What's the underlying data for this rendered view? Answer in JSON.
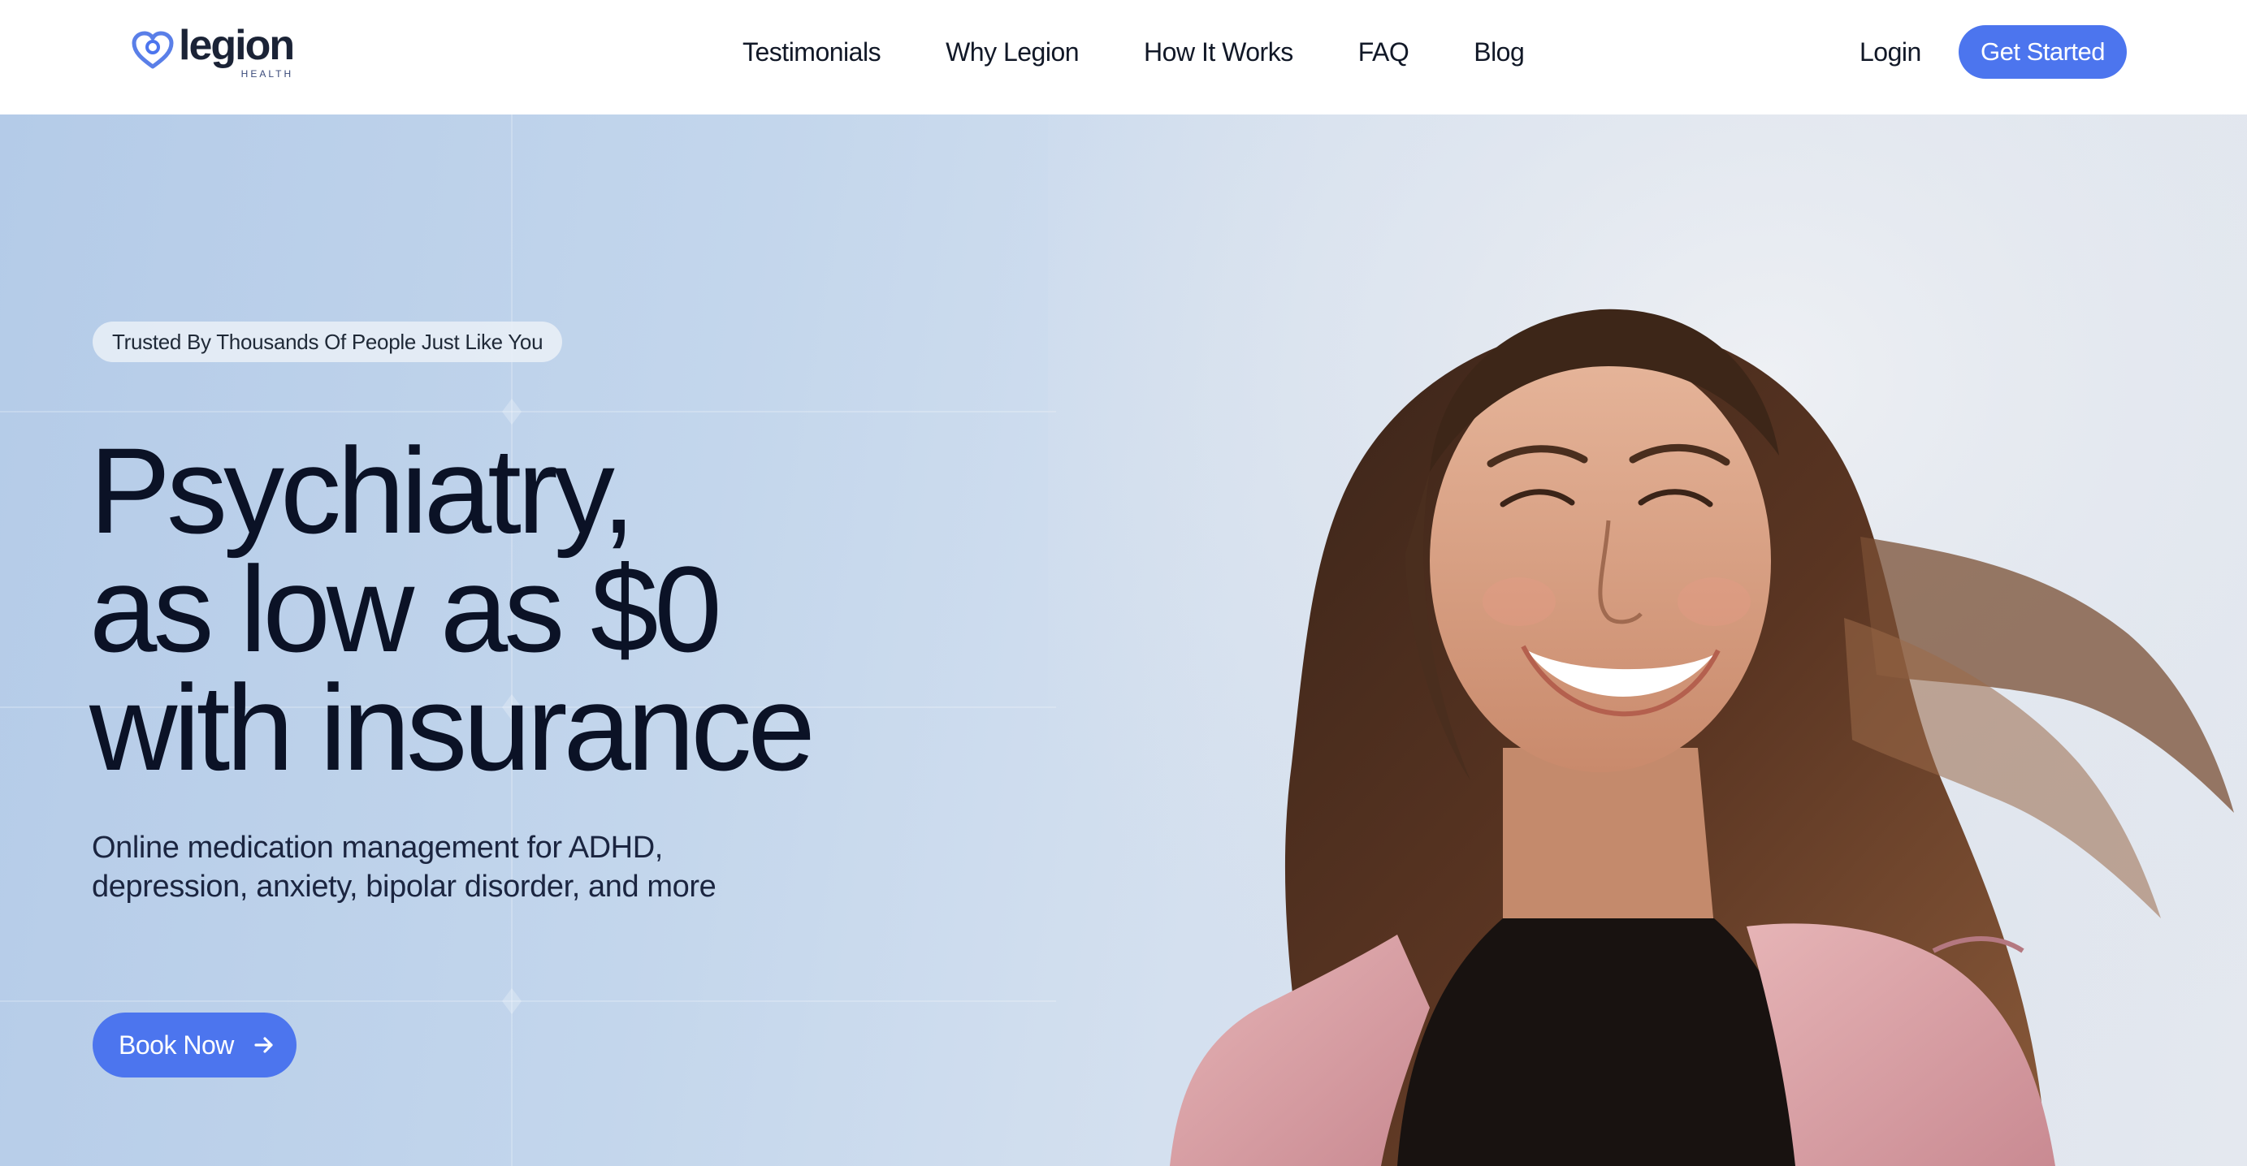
{
  "brand": {
    "name": "legion",
    "sub": "HEALTH",
    "accent_color": "#4c75ee",
    "logo_icon": "heart-logo-icon"
  },
  "nav": {
    "items": [
      {
        "label": "Testimonials"
      },
      {
        "label": "Why Legion"
      },
      {
        "label": "How It Works"
      },
      {
        "label": "FAQ"
      },
      {
        "label": "Blog"
      }
    ],
    "login_label": "Login",
    "cta_label": "Get Started"
  },
  "hero": {
    "badge": "Trusted By Thousands Of People Just Like You",
    "headline_lines": [
      "Psychiatry,",
      "as low as $0",
      "with insurance"
    ],
    "subtitle_lines": [
      "Online medication management for ADHD,",
      "depression, anxiety, bipolar disorder, and more"
    ],
    "cta_label": "Book Now",
    "cta_icon": "arrow-right-icon",
    "image_subject": "smiling-woman-photo"
  }
}
